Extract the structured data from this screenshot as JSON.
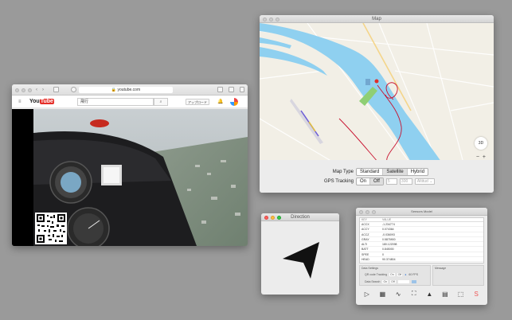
{
  "browser": {
    "address": "youtube.com",
    "nav_back": "‹",
    "nav_forward": "›",
    "youtube": {
      "logo_you": "You",
      "logo_tube": "Tube",
      "search_value": "飛行",
      "upload_label": "アップロード"
    }
  },
  "map_window": {
    "title": "Map",
    "compass_label": "3D",
    "zoom_out": "−",
    "zoom_in": "+",
    "legal": "Legal",
    "map_type": {
      "label": "Map Type",
      "options": [
        "Standard",
        "Satellite",
        "Hybrid"
      ],
      "selected": "Satellite"
    },
    "gps_tracking": {
      "label": "GPS Tracking",
      "options": [
        "On",
        "Off"
      ],
      "selected": "Off",
      "field1": "5",
      "field2": "300",
      "select_value": "Altitud"
    },
    "colors": {
      "water": "#8fd0f0",
      "track": "#c8102e",
      "park": "#8fcf74"
    }
  },
  "direction_window": {
    "title": "Direction"
  },
  "sensors_window": {
    "title": "Sensors Model",
    "columns": [
      "KEY",
      "VALUE"
    ],
    "rows": [
      {
        "k": "ACCX",
        "v": "-1.234774"
      },
      {
        "k": "ACCY",
        "v": "0.074364"
      },
      {
        "k": "ACCZ",
        "v": "-0.036093"
      },
      {
        "k": "GRAY",
        "v": "0.5875900"
      },
      {
        "k": "ALTI",
        "v": "180.122098"
      },
      {
        "k": "BATT",
        "v": "0.845000"
      },
      {
        "k": "SPEE",
        "v": "0"
      },
      {
        "k": "HEAD",
        "v": "90.374804"
      }
    ],
    "settings_title": "Data Settings",
    "message_title": "Message",
    "qr_tracking_label": "QR code Tracking",
    "qr_on": "On",
    "qr_off": "Off",
    "fps_label": "60 FPS",
    "data_search_label": "Data Search",
    "ds_on": "On",
    "ds_off": "Off"
  }
}
